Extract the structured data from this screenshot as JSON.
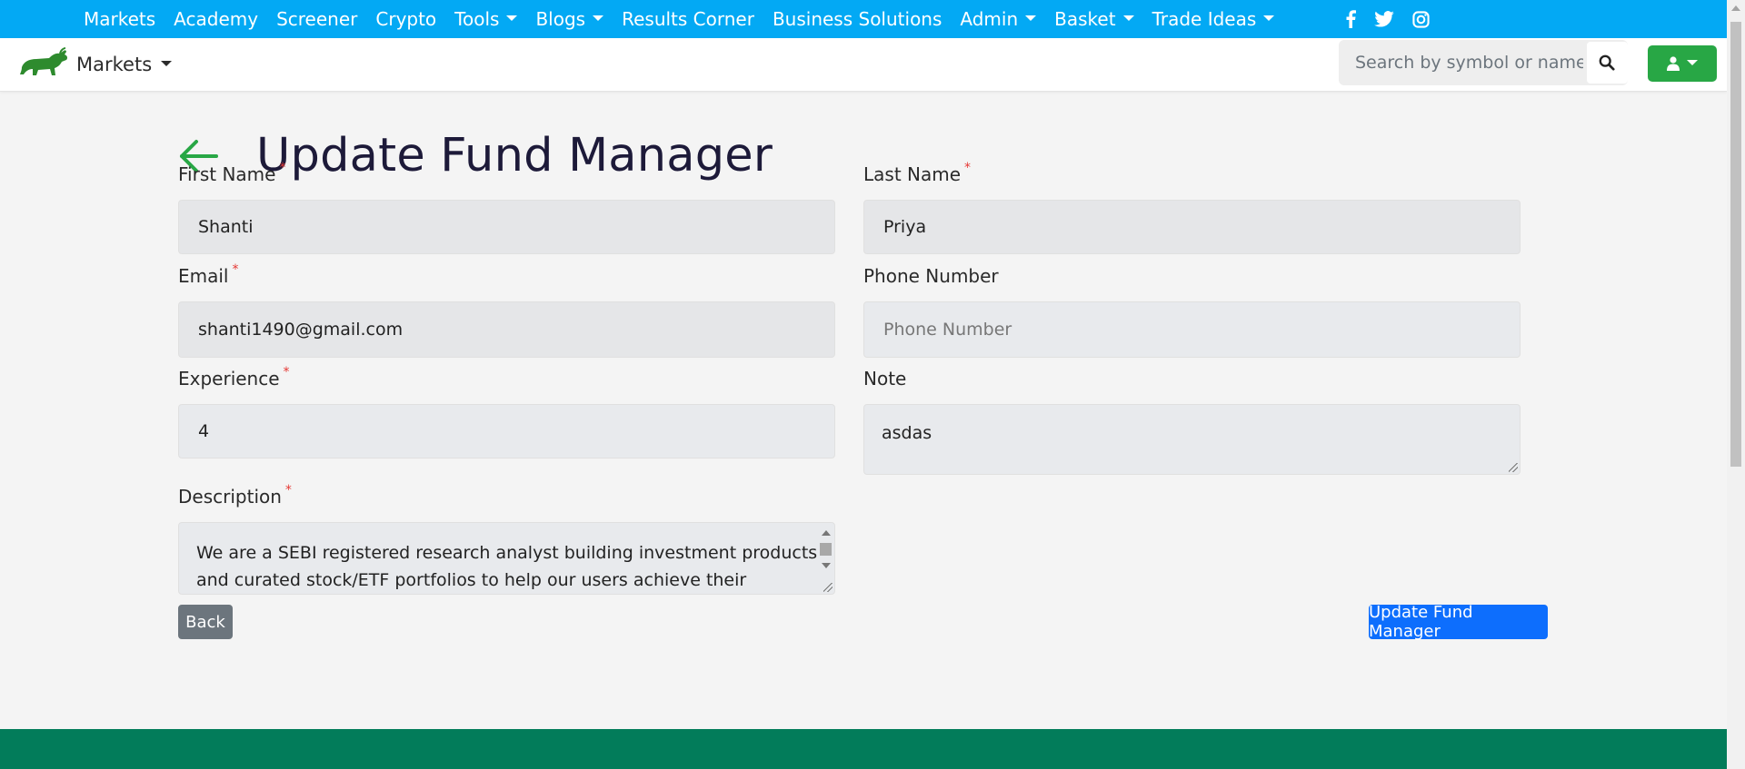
{
  "topnav": {
    "items": [
      {
        "label": "Markets",
        "dropdown": false
      },
      {
        "label": "Academy",
        "dropdown": false
      },
      {
        "label": "Screener",
        "dropdown": false
      },
      {
        "label": "Crypto",
        "dropdown": false
      },
      {
        "label": "Tools",
        "dropdown": true
      },
      {
        "label": "Blogs",
        "dropdown": true
      },
      {
        "label": "Results Corner",
        "dropdown": false
      },
      {
        "label": "Business Solutions",
        "dropdown": false
      },
      {
        "label": "Admin",
        "dropdown": true
      },
      {
        "label": "Basket",
        "dropdown": true
      },
      {
        "label": "Trade Ideas",
        "dropdown": true
      }
    ],
    "social_icons": [
      "facebook-icon",
      "twitter-icon",
      "instagram-icon"
    ],
    "background": "#03a9f4"
  },
  "subbar": {
    "brand_label": "Markets",
    "search_placeholder": "Search by symbol or name",
    "user_button_color": "#28a745"
  },
  "page": {
    "title": "Update Fund Manager",
    "back_icon": "arrow-left-icon"
  },
  "form": {
    "first_name": {
      "label": "First Name",
      "required": true,
      "value": "Shanti"
    },
    "last_name": {
      "label": "Last Name",
      "required": true,
      "value": "Priya"
    },
    "email": {
      "label": "Email",
      "required": true,
      "value": "shanti1490@gmail.com"
    },
    "phone": {
      "label": "Phone Number",
      "required": false,
      "value": "",
      "placeholder": "Phone Number"
    },
    "experience": {
      "label": "Experience",
      "required": true,
      "value": "4"
    },
    "note": {
      "label": "Note",
      "required": false,
      "value": "asdas"
    },
    "description": {
      "label": "Description",
      "required": true,
      "value": "We are a SEBI registered research analyst building investment products and curated stock/ETF portfolios to help our users achieve their financial goals."
    },
    "required_mark": "*"
  },
  "actions": {
    "back_label": "Back",
    "update_label": "Update Fund Manager"
  },
  "colors": {
    "footer": "#027c5a",
    "primary": "#0d6efd",
    "secondary": "#6c757d",
    "accent_green": "#28a745"
  }
}
